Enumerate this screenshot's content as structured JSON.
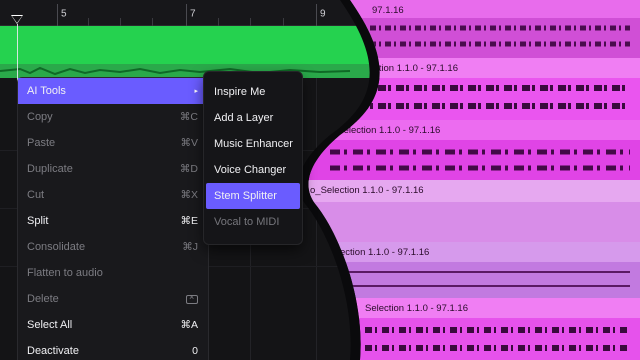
{
  "ruler": {
    "bars": [
      "5",
      "7",
      "9"
    ]
  },
  "clips": [
    {
      "label": "97.1.16"
    },
    {
      "label": "Selection 1.1.0 - 97.1.16"
    },
    {
      "label": "_Selection 1.1.0 - 97.1.16"
    },
    {
      "label": "o_Selection 1.1.0 - 97.1.16"
    },
    {
      "label": "ection 1.1.0 - 97.1.16"
    },
    {
      "label": "Selection 1.1.0 - 97.1.16"
    }
  ],
  "menu": {
    "items": [
      {
        "label": "AI Tools",
        "shortcut": "▸",
        "state": "active"
      },
      {
        "label": "Copy",
        "shortcut": "⌘C",
        "state": "disabled"
      },
      {
        "label": "Paste",
        "shortcut": "⌘V",
        "state": "disabled"
      },
      {
        "label": "Duplicate",
        "shortcut": "⌘D",
        "state": "disabled"
      },
      {
        "label": "Cut",
        "shortcut": "⌘X",
        "state": "disabled"
      },
      {
        "label": "Split",
        "shortcut": "⌘E",
        "state": "enabled"
      },
      {
        "label": "Consolidate",
        "shortcut": "⌘J",
        "state": "disabled"
      },
      {
        "label": "Flatten to audio",
        "shortcut": "",
        "state": "disabled"
      },
      {
        "label": "Delete",
        "shortcut": "",
        "state": "disabled"
      },
      {
        "label": "Select All",
        "shortcut": "⌘A",
        "state": "enabled"
      },
      {
        "label": "Deactivate",
        "shortcut": "0",
        "state": "enabled"
      }
    ]
  },
  "submenu": {
    "items": [
      {
        "label": "Inspire Me",
        "state": "enabled"
      },
      {
        "label": "Add a Layer",
        "state": "enabled"
      },
      {
        "label": "Music Enhancer",
        "state": "enabled"
      },
      {
        "label": "Voice Changer",
        "state": "enabled"
      },
      {
        "label": "Stem Splitter",
        "state": "active"
      },
      {
        "label": "Vocal to MIDI",
        "state": "disabled"
      }
    ]
  },
  "colors": {
    "accent": "#6a5cff",
    "green_track": "#25d24f",
    "clip_pink": "#f06af0",
    "clip_magenta": "#e34fe8",
    "clip_lilac": "#d79be8"
  }
}
